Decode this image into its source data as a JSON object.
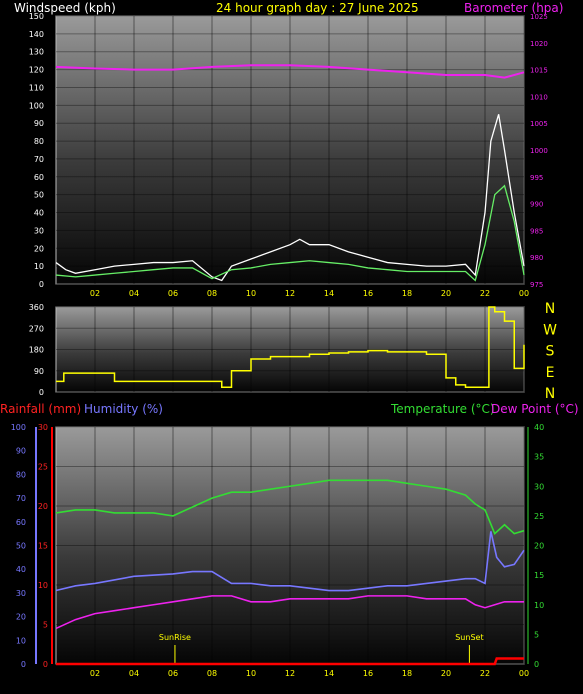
{
  "header": {
    "left_title": "Windspeed (kph)",
    "center_title": "24 hour graph day : 27 June 2025",
    "right_title": "Barometer (hpa)",
    "rain_title": "Rainfall (mm)",
    "humidity_title": "Humidity (%)",
    "temp_title": "Temperature (°C)",
    "dew_title": "Dew Point (°C)"
  },
  "colors": {
    "wind": "#ffffff",
    "gust": "#e0e0e0",
    "wind_avg": "#66ee66",
    "baro": "#ee22ee",
    "direction": "#ffff00",
    "rain": "#ff0000",
    "humidity": "#7777ff",
    "temperature": "#33dd33",
    "dewpoint": "#ee22ee",
    "time_labels": "#ffff00"
  },
  "chart_data": [
    {
      "type": "line",
      "title": "24 hour graph day : 27 June 2025",
      "x_ticks": [
        "02",
        "04",
        "06",
        "08",
        "10",
        "12",
        "14",
        "16",
        "18",
        "20",
        "22",
        "00"
      ],
      "x_range_hours": [
        0,
        24
      ],
      "y_left": {
        "label": "Windspeed (kph)",
        "ticks": [
          0,
          10,
          20,
          30,
          40,
          50,
          60,
          70,
          80,
          90,
          100,
          110,
          120,
          130,
          140,
          150
        ],
        "ylim": [
          0,
          150
        ]
      },
      "y_right": {
        "label": "Barometer (hpa)",
        "ticks": [
          975,
          980,
          985,
          990,
          995,
          1000,
          1005,
          1010,
          1015,
          1020,
          1025
        ],
        "ylim": [
          975,
          1025
        ]
      },
      "series": [
        {
          "name": "Windspeed (kph)",
          "axis": "left",
          "color": "#ffffff",
          "x": [
            0,
            0.5,
            1,
            2,
            3,
            4,
            5,
            6,
            7,
            8,
            8.5,
            9,
            10,
            11,
            12,
            12.5,
            13,
            14,
            15,
            16,
            17,
            18,
            19,
            20,
            21,
            21.5,
            22,
            22.3,
            22.7,
            23,
            23.5,
            24
          ],
          "y": [
            12,
            8,
            6,
            8,
            10,
            11,
            12,
            12,
            13,
            4,
            2,
            10,
            14,
            18,
            22,
            25,
            22,
            22,
            18,
            15,
            12,
            11,
            10,
            10,
            11,
            5,
            40,
            80,
            95,
            75,
            40,
            10
          ]
        },
        {
          "name": "Windspeed average (kph)",
          "axis": "left",
          "color": "#66ee66",
          "x": [
            0,
            1,
            2,
            3,
            4,
            5,
            6,
            7,
            8,
            9,
            10,
            11,
            12,
            13,
            14,
            15,
            16,
            17,
            18,
            19,
            20,
            21,
            21.5,
            22,
            22.5,
            23,
            23.5,
            24
          ],
          "y": [
            5,
            4,
            5,
            6,
            7,
            8,
            9,
            9,
            3,
            8,
            9,
            11,
            12,
            13,
            12,
            11,
            9,
            8,
            7,
            7,
            7,
            7,
            2,
            22,
            50,
            55,
            35,
            5
          ]
        },
        {
          "name": "Barometer (hpa)",
          "axis": "right",
          "color": "#ee22ee",
          "x": [
            0,
            2,
            4,
            6,
            8,
            10,
            12,
            14,
            16,
            18,
            20,
            22,
            23,
            24
          ],
          "y": [
            1015.5,
            1015.2,
            1015,
            1015,
            1015.5,
            1015.8,
            1015.8,
            1015.5,
            1015,
            1014.5,
            1014,
            1014,
            1013.5,
            1014.5
          ]
        }
      ]
    },
    {
      "type": "line",
      "title": "",
      "x_ticks": [
        "02",
        "04",
        "06",
        "08",
        "10",
        "12",
        "14",
        "16",
        "18",
        "20",
        "22",
        "00"
      ],
      "y_left": {
        "ticks": [
          0,
          90,
          180,
          270,
          360
        ],
        "ylim": [
          0,
          360
        ]
      },
      "y_right_labels": [
        "N",
        "W",
        "S",
        "E",
        "N"
      ],
      "series": [
        {
          "name": "Wind direction",
          "color": "#ffff00",
          "x": [
            0,
            0.4,
            1,
            2,
            3,
            4,
            5,
            6,
            7,
            8,
            8.5,
            9,
            10,
            11,
            12,
            13,
            14,
            15,
            16,
            17,
            18,
            19,
            20,
            20.5,
            21,
            22,
            22.2,
            22.5,
            23,
            23.5,
            24
          ],
          "y": [
            45,
            80,
            80,
            80,
            45,
            45,
            45,
            45,
            45,
            45,
            20,
            90,
            140,
            150,
            150,
            160,
            165,
            170,
            175,
            170,
            170,
            160,
            60,
            30,
            20,
            20,
            360,
            340,
            300,
            100,
            200
          ]
        }
      ]
    },
    {
      "type": "line",
      "title": "",
      "x_ticks": [
        "02",
        "04",
        "06",
        "08",
        "10",
        "12",
        "14",
        "16",
        "18",
        "20",
        "22",
        "00"
      ],
      "y_left_rain": {
        "label": "Rainfall (mm)",
        "ticks": [
          0,
          5,
          10,
          15,
          20,
          25,
          30
        ],
        "ylim": [
          0,
          30
        ]
      },
      "y_left_humidity": {
        "label": "Humidity (%)",
        "ticks": [
          0,
          10,
          20,
          30,
          40,
          50,
          60,
          70,
          80,
          90,
          100
        ],
        "ylim": [
          0,
          100
        ]
      },
      "y_right": {
        "label": "Temperature (°C)",
        "ticks": [
          0,
          5,
          10,
          15,
          20,
          25,
          30,
          35,
          40
        ],
        "ylim": [
          0,
          40
        ]
      },
      "annotations": [
        {
          "text": "SunRise",
          "x": 6.1
        },
        {
          "text": "SunSet",
          "x": 21.2
        }
      ],
      "series": [
        {
          "name": "Rainfall (mm)",
          "axis": "rain",
          "color": "#ff0000",
          "x": [
            0,
            22.5,
            22.6,
            23.5,
            24
          ],
          "y": [
            0,
            0,
            0.7,
            0.7,
            0.7
          ]
        },
        {
          "name": "Humidity (%)",
          "axis": "humidity",
          "color": "#7777ff",
          "x": [
            0,
            1,
            2,
            4,
            6,
            7,
            8,
            9,
            10,
            11,
            12,
            13,
            14,
            15,
            16,
            17,
            18,
            19,
            20,
            21,
            21.5,
            22,
            22.3,
            22.6,
            23,
            23.5,
            24
          ],
          "y": [
            31,
            33,
            34,
            37,
            38,
            39,
            39,
            34,
            34,
            33,
            33,
            32,
            31,
            31,
            32,
            33,
            33,
            34,
            35,
            36,
            36,
            34,
            56,
            45,
            41,
            42,
            48
          ]
        },
        {
          "name": "Temperature (°C)",
          "axis": "right",
          "color": "#33dd33",
          "x": [
            0,
            1,
            2,
            3,
            4,
            5,
            6,
            7,
            8,
            9,
            10,
            11,
            12,
            13,
            14,
            15,
            16,
            17,
            18,
            19,
            20,
            21,
            21.5,
            22,
            22.5,
            23,
            23.5,
            24
          ],
          "y": [
            25.5,
            26,
            26,
            25.5,
            25.5,
            25.5,
            25,
            26.5,
            28,
            29,
            29,
            29.5,
            30,
            30.5,
            31,
            31,
            31,
            31,
            30.5,
            30,
            29.5,
            28.5,
            27,
            26,
            22,
            23.5,
            22,
            22.5
          ]
        },
        {
          "name": "Dew Point (°C)",
          "axis": "right",
          "color": "#ee22ee",
          "x": [
            0,
            1,
            2,
            3,
            4,
            5,
            6,
            7,
            8,
            9,
            10,
            11,
            12,
            13,
            14,
            15,
            16,
            17,
            18,
            19,
            20,
            21,
            21.5,
            22,
            22.5,
            23,
            23.5,
            24
          ],
          "y": [
            6,
            7.5,
            8.5,
            9,
            9.5,
            10,
            10.5,
            11,
            11.5,
            11.5,
            10.5,
            10.5,
            11,
            11,
            11,
            11,
            11.5,
            11.5,
            11.5,
            11,
            11,
            11,
            10,
            9.5,
            10,
            10.5,
            10.5,
            10.5
          ]
        }
      ]
    }
  ]
}
